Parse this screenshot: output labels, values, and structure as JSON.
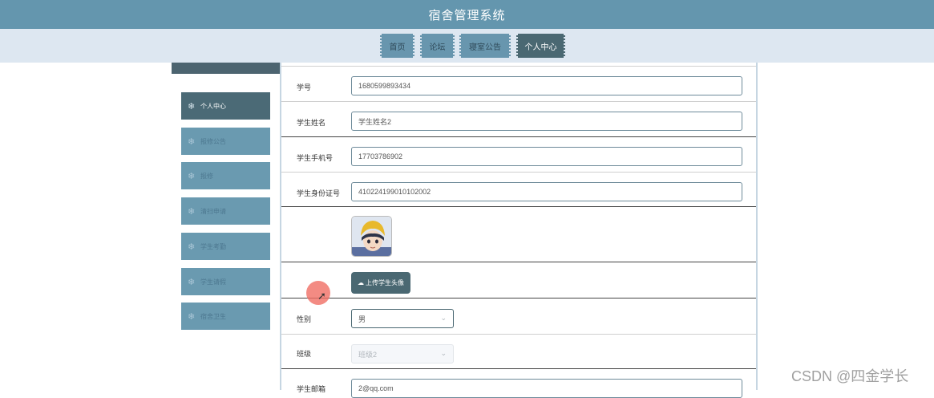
{
  "app": {
    "title": "宿舍管理系统"
  },
  "nav": {
    "items": [
      {
        "label": "首页",
        "active": false
      },
      {
        "label": "论坛",
        "active": false
      },
      {
        "label": "寝室公告",
        "active": false
      },
      {
        "label": "个人中心",
        "active": true
      }
    ]
  },
  "sidebar": {
    "icon": "snowflake-icon",
    "items": [
      {
        "label": "个人中心",
        "active": true
      },
      {
        "label": "报修公告"
      },
      {
        "label": "报修"
      },
      {
        "label": "清扫申请"
      },
      {
        "label": "学生考勤"
      },
      {
        "label": "学生请假"
      },
      {
        "label": "宿舍卫生"
      }
    ]
  },
  "form": {
    "student_no": {
      "label": "学号",
      "value": "1680599893434"
    },
    "student_name": {
      "label": "学生姓名",
      "value": "学生姓名2"
    },
    "student_phone": {
      "label": "学生手机号",
      "value": "17703786902"
    },
    "student_id_card": {
      "label": "学生身份证号",
      "value": "410224199010102002"
    },
    "upload_button": "上传学生头像",
    "gender": {
      "label": "性别",
      "value": "男"
    },
    "class": {
      "label": "班级",
      "value": "班级2"
    },
    "email": {
      "label": "学生邮箱",
      "value": "2@qq.com"
    }
  },
  "watermark": "CSDN @四金学长",
  "colors": {
    "header": "#6496ae",
    "nav_bg": "#dde7f1",
    "active": "#4a6872",
    "item": "#6896ae"
  }
}
